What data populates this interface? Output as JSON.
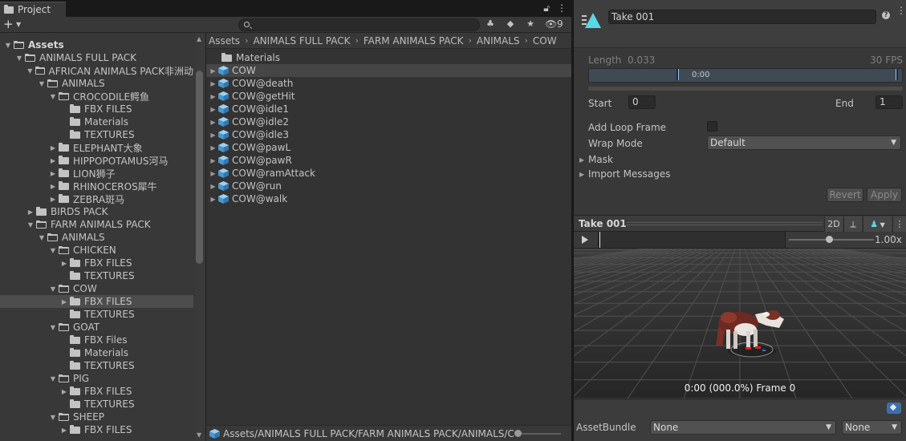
{
  "project": {
    "tab_label": "Project",
    "hidden_count": "9",
    "search": {
      "placeholder": ""
    },
    "tree": [
      {
        "label": "Assets",
        "depth": 0,
        "arrow": "▼",
        "open": true,
        "root": true
      },
      {
        "label": "ANIMALS FULL PACK",
        "depth": 1,
        "arrow": "▼",
        "open": true
      },
      {
        "label": "AFRICAN ANIMALS PACK非洲动",
        "depth": 2,
        "arrow": "▼",
        "open": true
      },
      {
        "label": "ANIMALS",
        "depth": 3,
        "arrow": "▼",
        "open": true
      },
      {
        "label": "CROCODILE鳄鱼",
        "depth": 4,
        "arrow": "▼",
        "open": true
      },
      {
        "label": "FBX FILES",
        "depth": 5,
        "arrow": "",
        "open": false
      },
      {
        "label": "Materials",
        "depth": 5,
        "arrow": "",
        "open": false
      },
      {
        "label": "TEXTURES",
        "depth": 5,
        "arrow": "",
        "open": false
      },
      {
        "label": "ELEPHANT大象",
        "depth": 4,
        "arrow": "▶",
        "open": false
      },
      {
        "label": "HIPPOPOTAMUS河马",
        "depth": 4,
        "arrow": "▶",
        "open": false
      },
      {
        "label": "LION狮子",
        "depth": 4,
        "arrow": "▶",
        "open": false
      },
      {
        "label": "RHINOCEROS犀牛",
        "depth": 4,
        "arrow": "▶",
        "open": false
      },
      {
        "label": "ZEBRA斑马",
        "depth": 4,
        "arrow": "▶",
        "open": false
      },
      {
        "label": "BIRDS PACK",
        "depth": 2,
        "arrow": "▶",
        "open": false
      },
      {
        "label": "FARM ANIMALS PACK",
        "depth": 2,
        "arrow": "▼",
        "open": true
      },
      {
        "label": "ANIMALS",
        "depth": 3,
        "arrow": "▼",
        "open": true
      },
      {
        "label": "CHICKEN",
        "depth": 4,
        "arrow": "▼",
        "open": true
      },
      {
        "label": "FBX FILES",
        "depth": 5,
        "arrow": "▶",
        "open": false
      },
      {
        "label": "TEXTURES",
        "depth": 5,
        "arrow": "",
        "open": false
      },
      {
        "label": "COW",
        "depth": 4,
        "arrow": "▼",
        "open": true
      },
      {
        "label": "FBX FILES",
        "depth": 5,
        "arrow": "▶",
        "open": false,
        "selected": true
      },
      {
        "label": "TEXTURES",
        "depth": 5,
        "arrow": "",
        "open": false
      },
      {
        "label": "GOAT",
        "depth": 4,
        "arrow": "▼",
        "open": true
      },
      {
        "label": "FBX Files",
        "depth": 5,
        "arrow": "",
        "open": false
      },
      {
        "label": "Materials",
        "depth": 5,
        "arrow": "",
        "open": false
      },
      {
        "label": "TEXTURES",
        "depth": 5,
        "arrow": "",
        "open": false
      },
      {
        "label": "PIG",
        "depth": 4,
        "arrow": "▼",
        "open": true
      },
      {
        "label": "FBX FILES",
        "depth": 5,
        "arrow": "▶",
        "open": false
      },
      {
        "label": "TEXTURES",
        "depth": 5,
        "arrow": "",
        "open": false
      },
      {
        "label": "SHEEP",
        "depth": 4,
        "arrow": "▼",
        "open": true
      },
      {
        "label": "FBX FILES",
        "depth": 5,
        "arrow": "▶",
        "open": false
      }
    ],
    "breadcrumb": [
      "Assets",
      "ANIMALS FULL PACK",
      "FARM ANIMALS PACK",
      "ANIMALS",
      "COW"
    ],
    "assets": [
      {
        "label": "Materials",
        "kind": "folder"
      },
      {
        "label": "COW",
        "kind": "model",
        "selected": true
      },
      {
        "label": "COW@death",
        "kind": "model"
      },
      {
        "label": "COW@getHit",
        "kind": "model"
      },
      {
        "label": "COW@idle1",
        "kind": "model"
      },
      {
        "label": "COW@idle2",
        "kind": "model"
      },
      {
        "label": "COW@idle3",
        "kind": "model"
      },
      {
        "label": "COW@pawL",
        "kind": "model"
      },
      {
        "label": "COW@pawR",
        "kind": "model"
      },
      {
        "label": "COW@ramAttack",
        "kind": "model"
      },
      {
        "label": "COW@run",
        "kind": "model"
      },
      {
        "label": "COW@walk",
        "kind": "model"
      }
    ],
    "path": "Assets/ANIMALS FULL PACK/FARM ANIMALS PACK/ANIMALS/C"
  },
  "inspector": {
    "clip_name": "Take 001",
    "length_label": "Length",
    "length_value": "0.033",
    "fps": "30 FPS",
    "timeline_start": "0:00",
    "start_label": "Start",
    "start_value": "0",
    "end_label": "End",
    "end_value": "1",
    "loop_label": "Add Loop Frame",
    "loop_checked": false,
    "wrap_label": "Wrap Mode",
    "wrap_value": "Default",
    "mask_label": "Mask",
    "import_label": "Import Messages",
    "revert_label": "Revert",
    "apply_label": "Apply"
  },
  "preview": {
    "title": "Take 001",
    "mode_2d": "2D",
    "speed": "1.00x",
    "speed_fraction": 0.5,
    "frame_label": "0:00 (000.0%) Frame 0"
  },
  "asset_bundle": {
    "label": "AssetBundle",
    "bundle_value": "None",
    "variant_value": "None"
  },
  "colors": {
    "accent": "#56d8e6",
    "selection": "#4d4d4d",
    "panel": "#383838"
  }
}
